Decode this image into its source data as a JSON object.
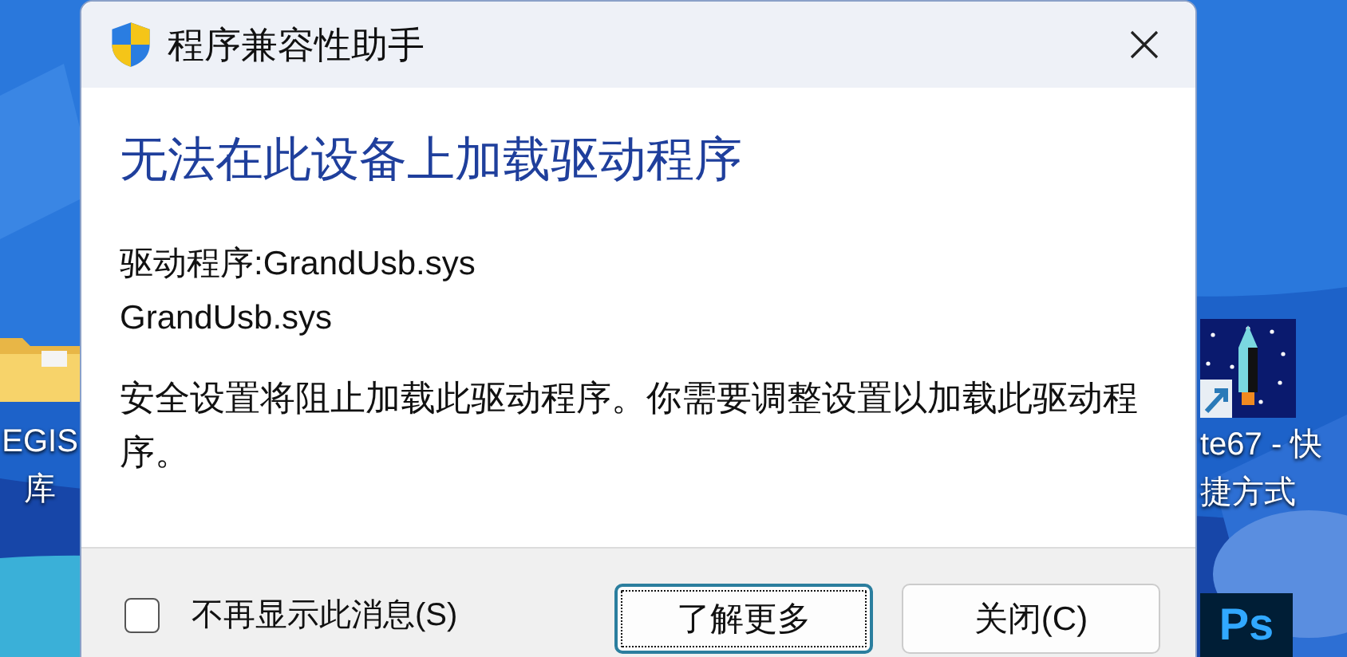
{
  "desktop": {
    "icons": [
      {
        "kind": "folder",
        "label_lines": [
          "EGIS",
          "库"
        ]
      },
      {
        "kind": "rocket",
        "label_lines": [
          "te67 - 快",
          "捷方式"
        ]
      },
      {
        "kind": "app",
        "glyph": "Ps"
      }
    ]
  },
  "dialog": {
    "title": "程序兼容性助手",
    "heading": "无法在此设备上加载驱动程序",
    "details": [
      "驱动程序:GrandUsb.sys",
      "GrandUsb.sys"
    ],
    "message": "安全设置将阻止加载此驱动程序。你需要调整设置以加载此驱动程序。",
    "checkbox": {
      "label": "不再显示此消息(S)",
      "checked": false
    },
    "buttons": [
      {
        "label": "了解更多",
        "focused": true
      },
      {
        "label": "关闭(C)",
        "focused": false
      }
    ]
  }
}
